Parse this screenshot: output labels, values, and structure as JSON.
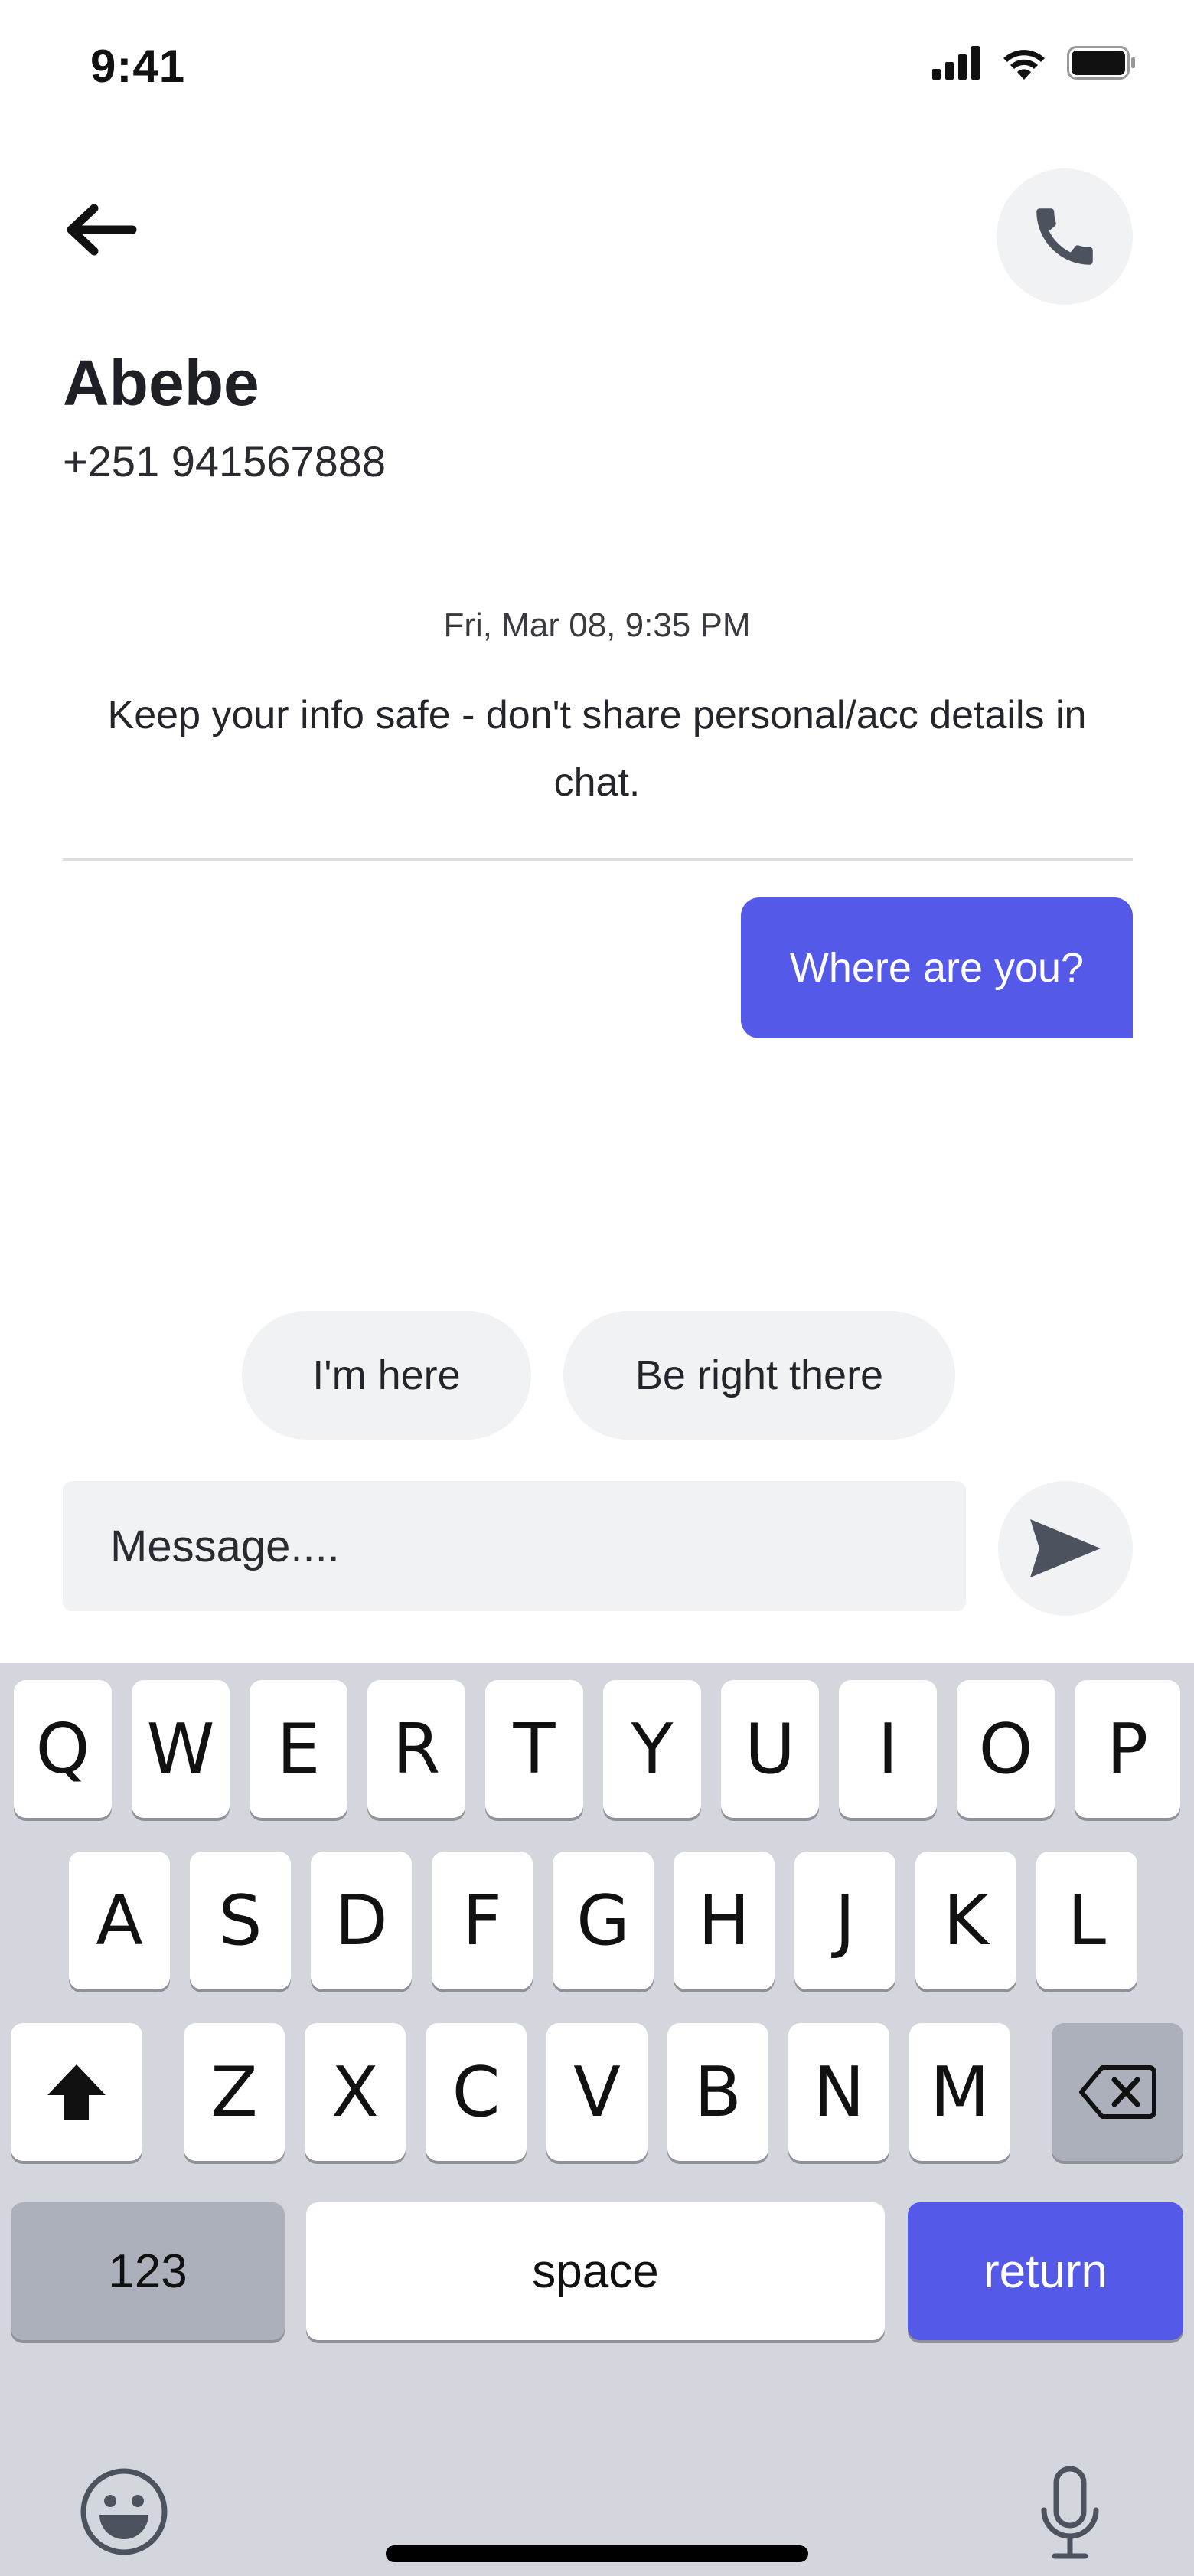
{
  "status_bar": {
    "time": "9:41"
  },
  "header": {
    "back_icon": "arrow-left-icon",
    "call_icon": "phone-icon"
  },
  "contact": {
    "name": "Abebe",
    "phone": "+251 941567888"
  },
  "chat": {
    "timestamp": "Fri, Mar 08, 9:35 PM",
    "notice": "Keep your info safe - don't share personal/acc details in chat.",
    "messages": [
      {
        "direction": "outgoing",
        "text": "Where are you?"
      }
    ]
  },
  "quick_replies": [
    "I'm here",
    "Be right there"
  ],
  "composer": {
    "placeholder": "Message....",
    "value": "",
    "send_icon": "send-icon"
  },
  "keyboard": {
    "row1": [
      "Q",
      "W",
      "E",
      "R",
      "T",
      "Y",
      "U",
      "I",
      "O",
      "P"
    ],
    "row2": [
      "A",
      "S",
      "D",
      "F",
      "G",
      "H",
      "J",
      "K",
      "L"
    ],
    "row3": [
      "Z",
      "X",
      "C",
      "V",
      "B",
      "N",
      "M"
    ],
    "numbers_label": "123",
    "space_label": "space",
    "return_label": "return"
  },
  "colors": {
    "accent": "#5459e8",
    "bubble_text": "#ffffff",
    "chip_bg": "#f1f2f4",
    "keyboard_bg": "#d3d6dd",
    "key_dark": "#abb0bb"
  }
}
